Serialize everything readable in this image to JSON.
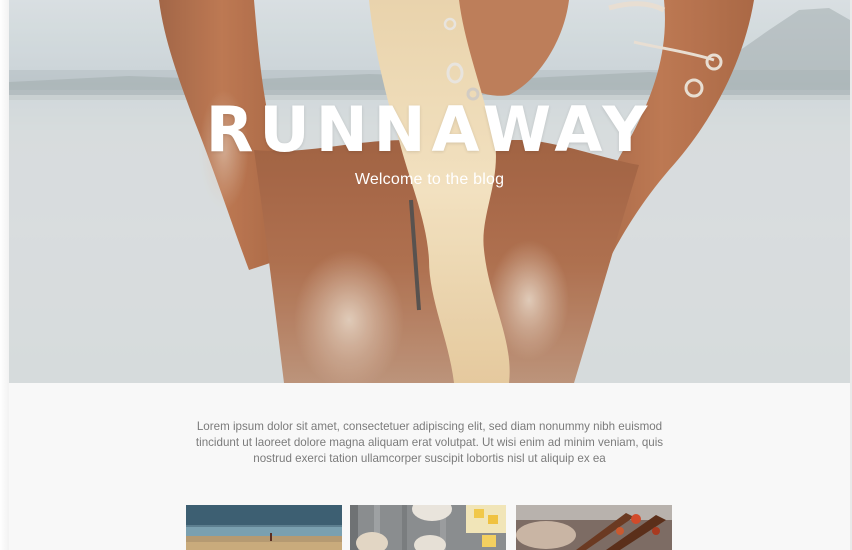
{
  "hero": {
    "title": "RUNNAWAY",
    "subtitle": "Welcome to the blog",
    "image_icon": "beach-woman-photo"
  },
  "intro": {
    "text": "Lorem ipsum dolor sit amet, consectetuer adipiscing elit, sed diam nonummy nibh euismod tincidunt ut laoreet dolore magna aliquam erat volutpat. Ut wisi enim ad minim veniam, quis nostrud exerci tation ullamcorper suscipit lobortis nisl ut aliquip ex ea"
  },
  "posts": [
    {
      "image_icon": "beach-thumbnail"
    },
    {
      "image_icon": "food-table-thumbnail"
    },
    {
      "image_icon": "grill-thumbnail"
    }
  ],
  "colors": {
    "text_gray": "#7b7b7b",
    "hero_text": "#ffffff",
    "background": "#f8f8f8"
  }
}
